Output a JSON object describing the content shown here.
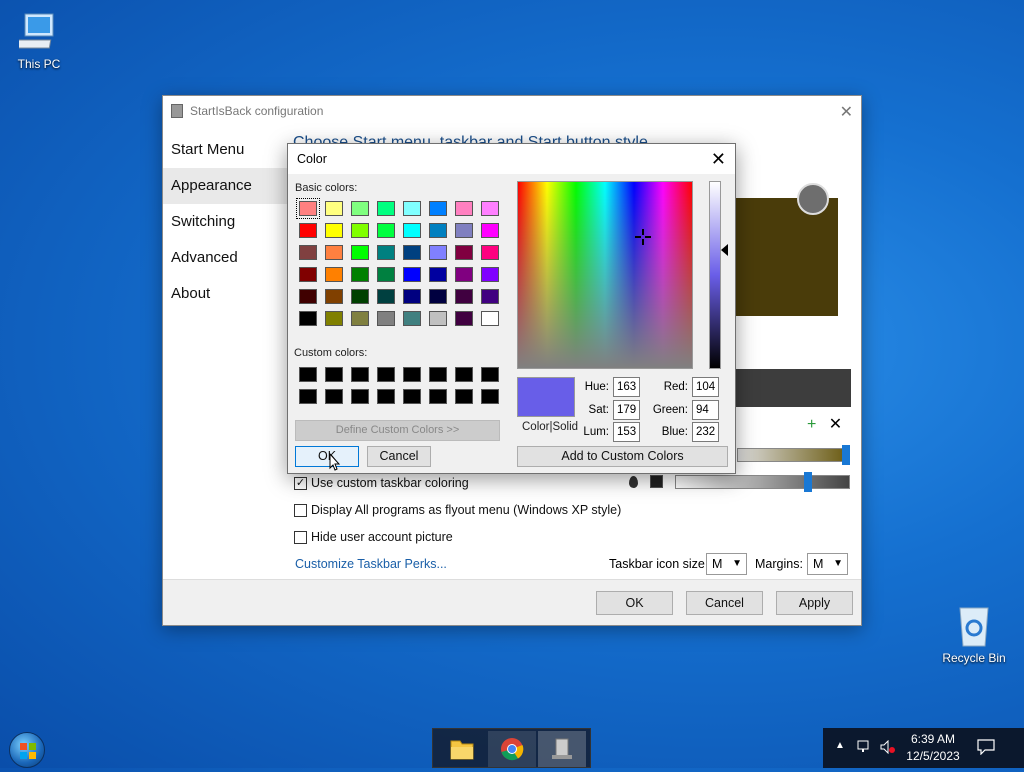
{
  "desktop": {
    "this_pc_label": "This PC",
    "recycle_bin_label": "Recycle Bin"
  },
  "config_window": {
    "title": "StartIsBack configuration",
    "nav": [
      "Start Menu",
      "Appearance",
      "Switching",
      "Advanced",
      "About"
    ],
    "active_nav": "Appearance",
    "heading": "Choose Start menu, taskbar and Start button style",
    "checkboxes": [
      {
        "label": "Use custom taskbar coloring",
        "checked": true
      },
      {
        "label": "Display All programs as flyout menu (Windows XP style)",
        "checked": false
      },
      {
        "label": "Hide user account picture",
        "checked": false
      }
    ],
    "link": "Customize Taskbar Perks...",
    "taskbar_icon_size_label": "Taskbar icon size:",
    "taskbar_icon_size_value": "M",
    "margins_label": "Margins:",
    "margins_value": "M",
    "ok_label": "OK",
    "cancel_label": "Cancel",
    "apply_label": "Apply",
    "preview_color": "#4a3c0a"
  },
  "color_dialog": {
    "title": "Color",
    "basic_colors_label": "Basic colors:",
    "basic_colors": [
      "#ff8080",
      "#ffff80",
      "#80ff80",
      "#00ff80",
      "#80ffff",
      "#0080ff",
      "#ff80c0",
      "#ff80ff",
      "#ff0000",
      "#ffff00",
      "#80ff00",
      "#00ff40",
      "#00ffff",
      "#0080c0",
      "#8080c0",
      "#ff00ff",
      "#804040",
      "#ff8040",
      "#00ff00",
      "#008080",
      "#004080",
      "#8080ff",
      "#800040",
      "#ff0080",
      "#800000",
      "#ff8000",
      "#008000",
      "#008040",
      "#0000ff",
      "#0000a0",
      "#800080",
      "#8000ff",
      "#400000",
      "#804000",
      "#004000",
      "#004040",
      "#000080",
      "#000040",
      "#400040",
      "#400080",
      "#000000",
      "#808000",
      "#808040",
      "#808080",
      "#408080",
      "#c0c0c0",
      "#400040",
      "#ffffff"
    ],
    "custom_colors_label": "Custom colors:",
    "custom_colors": [
      "#000000",
      "#000000",
      "#000000",
      "#000000",
      "#000000",
      "#000000",
      "#000000",
      "#000000",
      "#000000",
      "#000000",
      "#000000",
      "#000000",
      "#000000",
      "#000000",
      "#000000",
      "#000000"
    ],
    "define_custom_label": "Define Custom Colors >>",
    "color_solid_label": "Color|Solid",
    "current_color": "#685ee8",
    "hue_label": "Hue:",
    "hue": "163",
    "sat_label": "Sat:",
    "sat": "179",
    "lum_label": "Lum:",
    "lum": "153",
    "red_label": "Red:",
    "red": "104",
    "green_label": "Green:",
    "green": "94",
    "blue_label": "Blue:",
    "blue": "232",
    "ok_label": "OK",
    "cancel_label": "Cancel",
    "add_custom_label": "Add to Custom Colors"
  },
  "taskbar": {
    "time": "6:39 AM",
    "date": "12/5/2023"
  }
}
